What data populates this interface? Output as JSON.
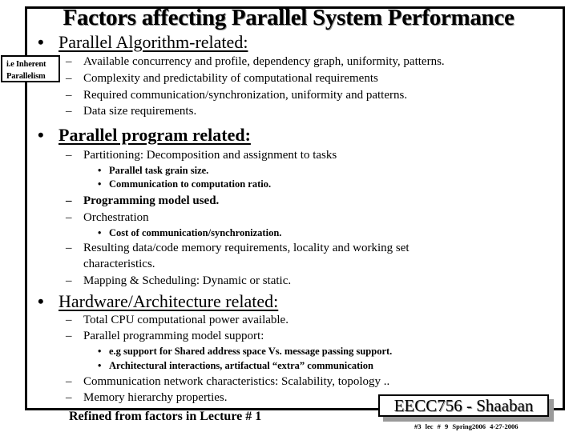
{
  "slide": {
    "title": "Factors affecting Parallel System Performance",
    "side_note": [
      "i.e Inherent",
      "Parallelism"
    ],
    "sections": [
      {
        "heading": "Parallel Algorithm-related:",
        "items": [
          {
            "text": "Available concurrency and profile, dependency graph, uniformity, patterns."
          },
          {
            "text": "Complexity and predictability of computational requirements"
          },
          {
            "text": "Required communication/synchronization, uniformity and patterns."
          },
          {
            "text": "Data size requirements."
          }
        ]
      },
      {
        "heading": "Parallel program related:",
        "items": [
          {
            "text": "Partitioning: Decomposition and assignment to tasks",
            "sub": [
              "Parallel task grain size.",
              "Communication to computation ratio."
            ]
          },
          {
            "text": "Programming model used.",
            "bold": true
          },
          {
            "text": "Orchestration",
            "sub": [
              "Cost of communication/synchronization."
            ]
          },
          {
            "text": "Resulting data/code memory requirements, locality and working set",
            "cont": "characteristics."
          },
          {
            "text": "Mapping & Scheduling: Dynamic or static."
          }
        ]
      },
      {
        "heading": "Hardware/Architecture related:",
        "items": [
          {
            "text": "Total CPU computational power available."
          },
          {
            "text": "Parallel programming model support:",
            "sub": [
              "e.g support for Shared address space Vs. message passing support.",
              "Architectural interactions, artifactual “extra” communication"
            ]
          },
          {
            "text": "Communication network characteristics: Scalability, topology .."
          },
          {
            "text": "Memory hierarchy properties."
          }
        ]
      }
    ],
    "footer_note": "Refined from factors in Lecture # 1",
    "badge": "EECC756 - Shaaban",
    "meta": "#3  lec # 9  Spring2006  4-27-2006",
    "bullet_glyph": "•",
    "dash_glyph": "–"
  }
}
